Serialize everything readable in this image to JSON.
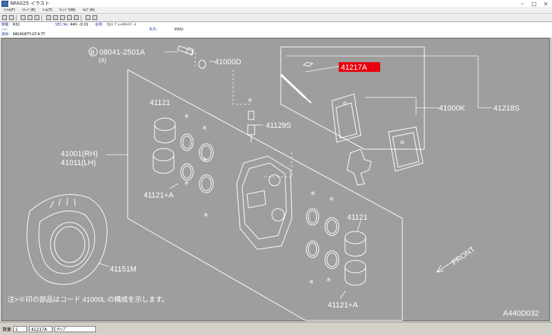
{
  "window": {
    "title": "NFA025 イラスト"
  },
  "menu": [
    "ﾌｧｲﾙ(F)",
    "ｲﾒｰｼﾞ(E)",
    "ﾂｰﾙ(T)",
    "ｳｨﾝﾄﾞｳ(W)",
    "ﾍﾙﾌﾟ(H)"
  ],
  "info": {
    "model_label": "車種：",
    "model_value": "R32",
    "sec_label": "SEC.No:",
    "sec_value": "440- -D 01",
    "name_label": "名称：",
    "name_value": "ﾌﾛﾝﾄ ﾌﾞﾚｰｷ(ｷｬﾘﾊﾟｰ)",
    "note_label": "ﾉｰﾄ：",
    "date_label": "年月：",
    "date_value": "9302-",
    "applic_label": "適用：",
    "applic_value": "RB26DETT-GT-R.TT"
  },
  "diagram": {
    "labels": {
      "bolt": "08041-2501A",
      "bolt_prefix": "B",
      "bolt_qty": "(4)",
      "cap": "41000D",
      "highlight": "41217A",
      "caliper_assy": "41000K",
      "caliper_set": "41218S",
      "bleeder": "41129S",
      "piston_top": "41121",
      "body_rh": "41001(RH)",
      "body_lh": "41011(LH)",
      "seal_left": "41121+A",
      "piston_right": "41121",
      "seal_right": "41121+A",
      "shield": "41151M",
      "front": "FRONT",
      "note": "注>※印の部品はコード 41000L の構成を示します。",
      "illust_id": "A440D032",
      "asterisk": "※"
    },
    "colors": {
      "background": "#9e9e9e",
      "line": "#ffffff",
      "highlight": "#e8000b"
    }
  },
  "status": {
    "qty_label": "数量",
    "qty_value": "1",
    "part_no": "41217A",
    "part_name": "ｸﾘｯﾌﾟ"
  }
}
